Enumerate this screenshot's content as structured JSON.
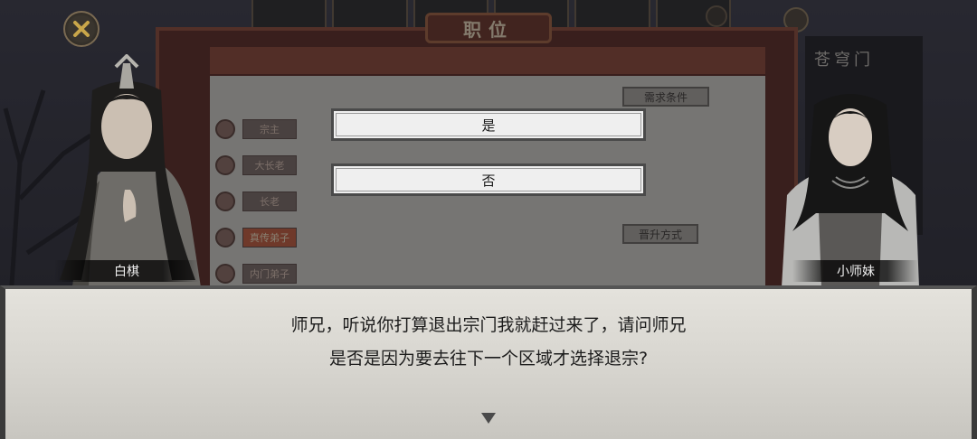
{
  "background_panel": {
    "title": "职位",
    "ranks": [
      "宗主",
      "大长老",
      "长老",
      "真传弟子",
      "内门弟子"
    ],
    "requirement_button": "需求条件",
    "promotion_button": "晋升方式",
    "right_title": "苍穹门"
  },
  "choices": {
    "yes_label": "是",
    "no_label": "否"
  },
  "characters": {
    "left_name": "白棋",
    "right_name": "小师妹"
  },
  "dialogue": {
    "line1": "师兄，听说你打算退出宗门我就赶过来了，请问师兄",
    "line2": "是否是因为要去往下一个区域才选择退宗?"
  },
  "colors": {
    "panel_frame": "#5a2a22",
    "active_rank": "#c25a3a",
    "dialogue_bg": "#dcdad4"
  },
  "icons": {
    "close": "close-icon",
    "advance": "triangle-down-icon"
  }
}
